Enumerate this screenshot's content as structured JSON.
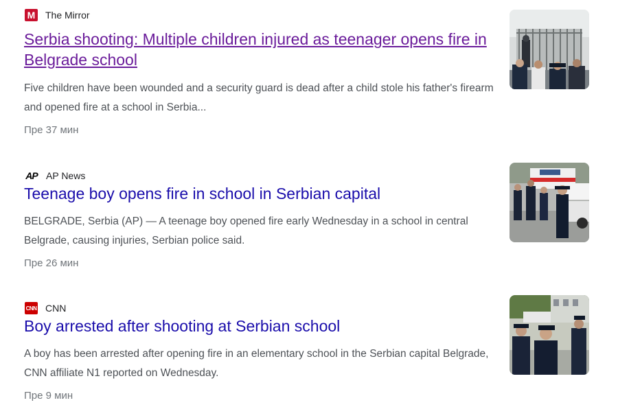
{
  "articles": [
    {
      "source": "The Mirror",
      "logo_text": "M",
      "logo_color": "#c8102e",
      "headline": "Serbia shooting: Multiple children injured as teenager opens fire in Belgrade school",
      "snippet": "Five children have been wounded and a security guard is dead after a child stole his father's firearm and opened fire at a school in Serbia...",
      "time": "Пре 37 мин",
      "visited": true
    },
    {
      "source": "AP News",
      "logo_text": "AP",
      "headline": "Teenage boy opens fire in school in Serbian capital",
      "snippet": "BELGRADE, Serbia (AP) — A teenage boy opened fire early Wednesday in a school in central Belgrade, causing injuries, Serbian police said.",
      "time": "Пре 26 мин",
      "visited": false
    },
    {
      "source": "CNN",
      "logo_text": "CNN",
      "logo_color": "#cc0000",
      "headline": "Boy arrested after shooting at Serbian school",
      "snippet": "A boy has been arrested after opening fire in an elementary school in the Serbian capital Belgrade, CNN affiliate N1 reported on Wednesday.",
      "time": "Пре 9 мин",
      "visited": false
    }
  ],
  "colors": {
    "link": "#1a0dab",
    "visited_link": "#6a1b9a",
    "snippet": "#4d5156",
    "time": "#70757a"
  }
}
